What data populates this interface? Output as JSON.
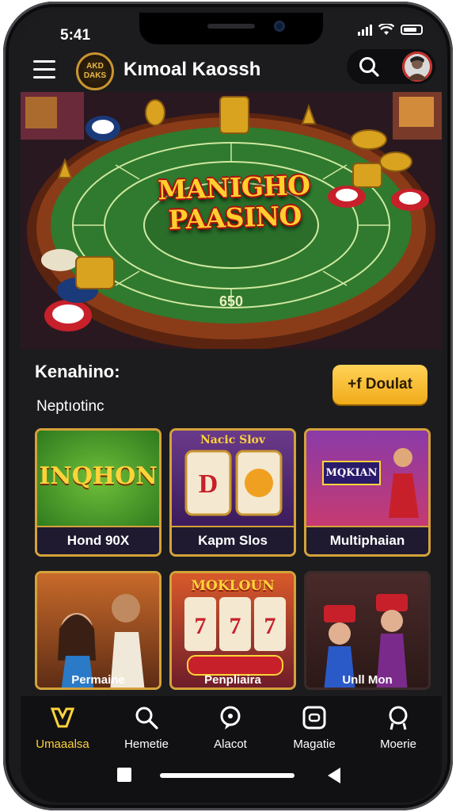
{
  "status_bar": {
    "time": "5:41"
  },
  "header": {
    "logo_text": "AKD DAKS",
    "title": "Kımoal Kaossh",
    "icons": [
      "menu-icon",
      "search-icon",
      "avatar"
    ]
  },
  "hero": {
    "title_line1": "MANIGHO",
    "title_line2": "PAASINO",
    "table_number": "650"
  },
  "section": {
    "heading": "Kenahino:",
    "subheading": "Neptıotinc",
    "cta_label": "+f Doulat"
  },
  "games": [
    {
      "label": "Hond 90X",
      "art_text": "INQHON"
    },
    {
      "label": "Kapm Slos",
      "art_text": "Nacic Slov"
    },
    {
      "label": "Multiphaian",
      "art_text": "MQKIAN"
    },
    {
      "label": "Permaine",
      "art_text": ""
    },
    {
      "label": "Penpliaira",
      "art_text": "MOKLOUN"
    },
    {
      "label": "Unll Mon",
      "art_text": ""
    }
  ],
  "bottom_nav": [
    {
      "label": "Umaaalsa",
      "icon": "casino-icon",
      "active": true
    },
    {
      "label": "Hemetie",
      "icon": "search-icon",
      "active": false
    },
    {
      "label": "Alacot",
      "icon": "chat-icon",
      "active": false
    },
    {
      "label": "Magatie",
      "icon": "wallet-icon",
      "active": false
    },
    {
      "label": "Moerie",
      "icon": "profile-icon",
      "active": false
    }
  ],
  "colors": {
    "accent": "#f0ab19",
    "card_border": "#d4a23a",
    "background": "#1c1c1e"
  }
}
